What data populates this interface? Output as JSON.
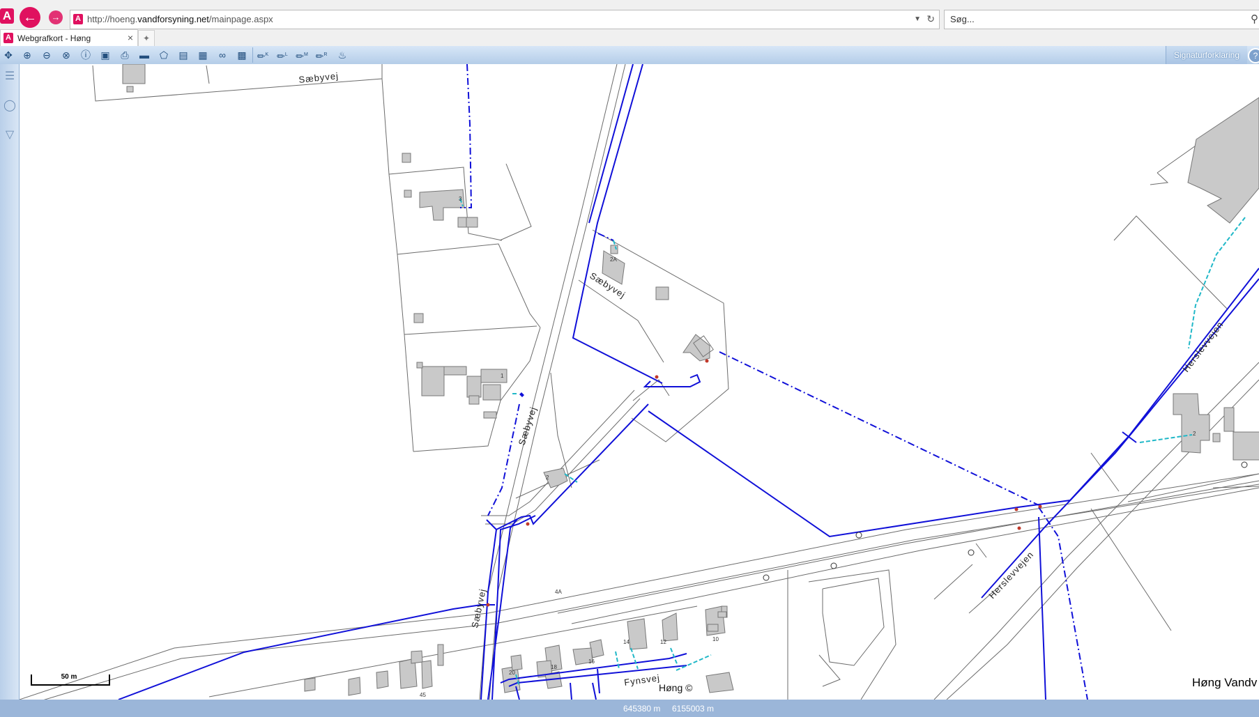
{
  "browser": {
    "logo": "A",
    "back_icon": "arrow-left-icon",
    "forward_icon": "arrow-right-icon",
    "url_prefix": "http://hoeng.",
    "url_domain": "vandforsyning.net",
    "url_path": "/mainpage.aspx",
    "search_placeholder": "Søg...",
    "tab_title": "Webgrafkort - Høng",
    "tab_close": "×"
  },
  "toolbar": {
    "tools": [
      "pan-icon",
      "zoom-in-icon",
      "zoom-out-icon",
      "zoom-extent-icon",
      "info-icon",
      "select-icon",
      "print-icon",
      "measure-icon",
      "polygon-icon",
      "clipboard-icon",
      "save-icon",
      "link-icon",
      "map-layer-icon",
      "pencil-k-icon",
      "pencil-l-icon",
      "pencil-m-icon",
      "pencil-r-icon",
      "water-tap-icon"
    ],
    "tool_letters": [
      "K",
      "L",
      "M",
      "R"
    ],
    "legend_label": "Signaturforklaring"
  },
  "sidebar": {
    "icons": [
      "layers-icon",
      "binoculars-icon",
      "filter-icon"
    ]
  },
  "map": {
    "road_labels": {
      "saebyvej_top": "Sæbyvej",
      "saebyvej_mid": "Sæbyvej",
      "saebyvej_center": "Sæbyvej",
      "saebyvej_bottom": "Sæbyvej",
      "herslevvejen_top": "Herslevvejen",
      "herslevvejen_bottom": "Herslevvejen",
      "fynsvej": "Fynsvej"
    },
    "house_numbers": [
      "3",
      "2A",
      "1",
      "2",
      "2",
      "4A",
      "20",
      "18",
      "16",
      "14",
      "12",
      "10",
      "45"
    ],
    "town_label": "Høng ©",
    "colors": {
      "water_main": "#1010d8",
      "service_line": "#21b8c8",
      "parcel_line": "#6b6b6b",
      "building_fill": "#c9c9c9",
      "valve": "#c0392b"
    }
  },
  "scale": {
    "label": "50 m"
  },
  "copyright": "Høng Vandv",
  "status": {
    "x": "645380 m",
    "y": "6155003 m"
  }
}
